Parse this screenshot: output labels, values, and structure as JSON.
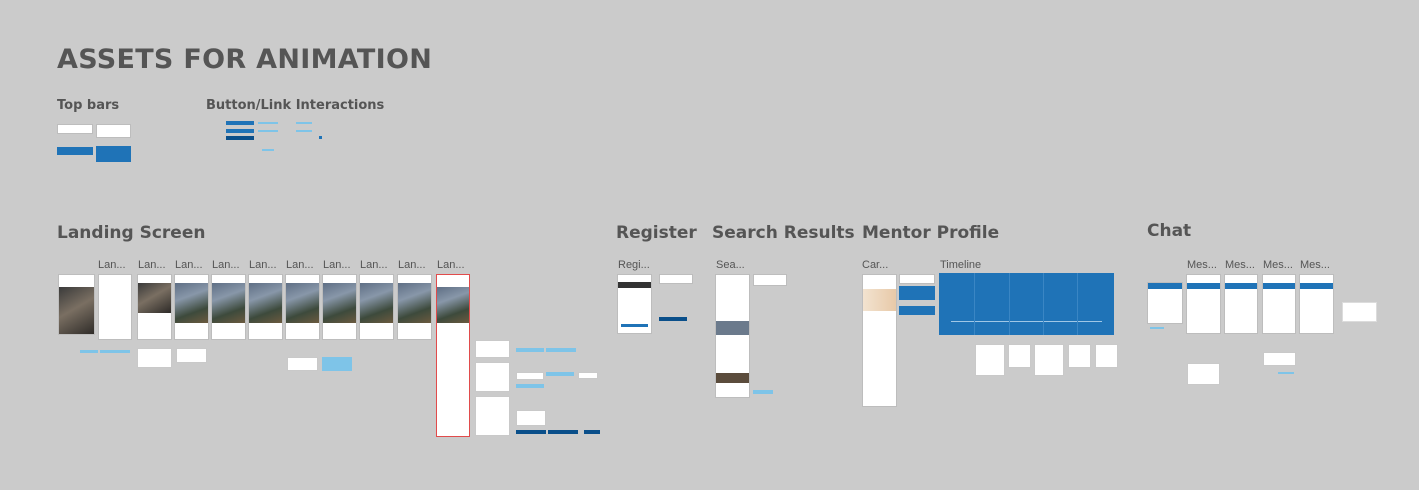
{
  "page_title": "ASSETS FOR ANIMATION",
  "sections": {
    "top_bars": "Top bars",
    "button_link": "Button/Link Interactions",
    "landing": "Landing Screen",
    "register": "Register",
    "search": "Search Results",
    "mentor": "Mentor Profile",
    "chat": "Chat"
  },
  "landing_frames": [
    "Lan...",
    "Lan...",
    "Lan...",
    "Lan...",
    "Lan...",
    "Lan...",
    "Lan...",
    "Lan...",
    "Lan..."
  ],
  "register_frame": "Regi...",
  "search_frame": "Sea...",
  "mentor_frames": {
    "card": "Car...",
    "timeline": "Timeline"
  },
  "chat_frames": [
    "Mes...",
    "Mes...",
    "Mes...",
    "Mes..."
  ],
  "colors": {
    "canvas": "#cbcbcb",
    "brand_blue": "#1f73b7",
    "dark_blue": "#0a4f8a",
    "link_blue": "#7ec4e8"
  }
}
